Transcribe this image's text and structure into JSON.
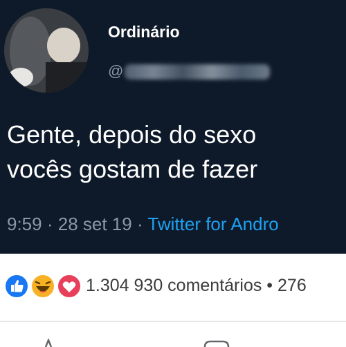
{
  "tweet": {
    "display_name": "Ordinário",
    "handle_prefix": "@",
    "text_lines": [
      "Gente, depois do sexo",
      "vocês gostam de fazer"
    ],
    "time": "9:59",
    "separator": "·",
    "date": "28 set 19",
    "source": "Twitter for Andro"
  },
  "reactions": {
    "icons": [
      "like-icon",
      "haha-icon",
      "love-icon"
    ],
    "count": "1.304",
    "comments": "930 comentários",
    "bullet": "•",
    "shares": "276"
  },
  "colors": {
    "tweet_background": "#0e1a29",
    "tweet_text": "#ffffff",
    "muted_text": "#8b98a5",
    "link_blue": "#1da1f2",
    "like_blue": "#1877f2",
    "haha_yellow": "#f7b125",
    "love_red": "#e8405a"
  }
}
